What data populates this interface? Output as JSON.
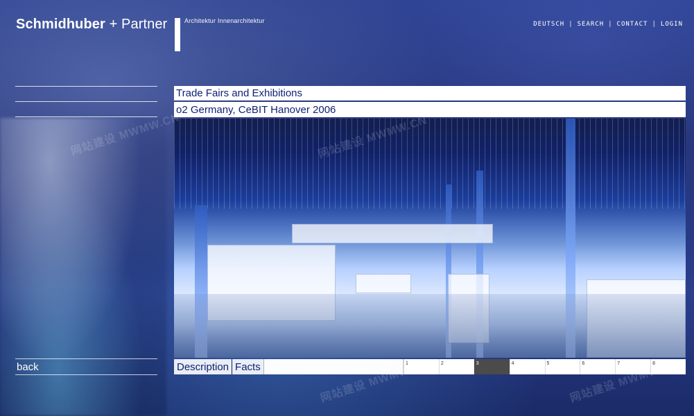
{
  "header": {
    "brand": {
      "name": "Schmidhuber",
      "plus": "+",
      "partner": "Partner"
    },
    "subtitle": "Architektur  Innenarchitektur"
  },
  "topnav": {
    "items": [
      {
        "label": "DEUTSCH"
      },
      {
        "label": "SEARCH"
      },
      {
        "label": "CONTACT"
      },
      {
        "label": "LOGIN"
      }
    ],
    "separator": "|"
  },
  "sidebar": {
    "back_label": "back"
  },
  "content": {
    "section_title": "Trade Fairs and Exhibitions",
    "project_title": "o2 Germany, CeBIT Hanover 2006",
    "tabs": [
      {
        "label": "Description"
      },
      {
        "label": "Facts"
      }
    ],
    "pager": {
      "current": 3,
      "pages": [
        "1",
        "2",
        "3",
        "4",
        "5",
        "6",
        "7",
        "8"
      ]
    }
  },
  "watermarks": {
    "brand": "MWMW.CN",
    "han": "网站建设"
  },
  "colors": {
    "accent": "#0b1f73",
    "active_page": "#4b4b4b"
  }
}
